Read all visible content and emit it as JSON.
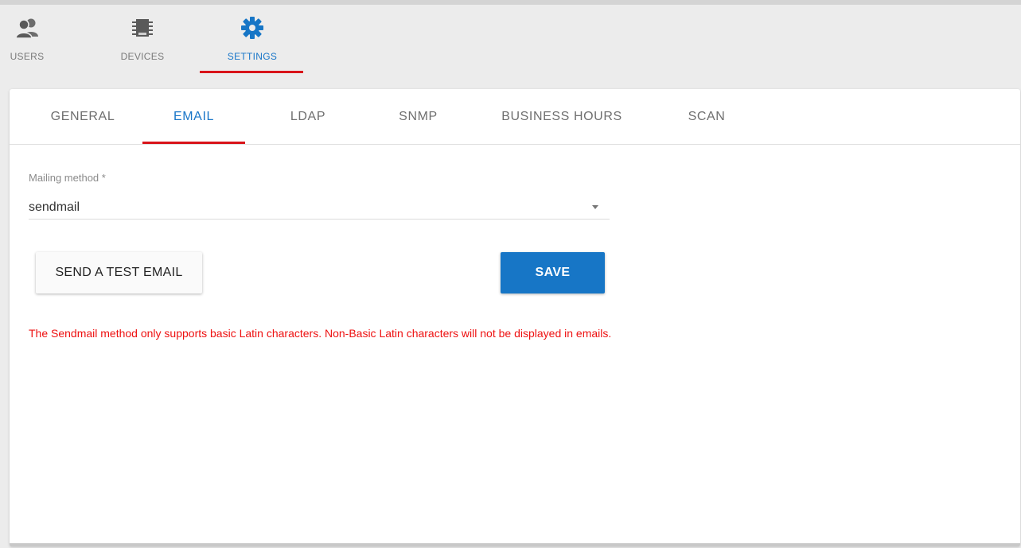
{
  "nav": {
    "items": [
      {
        "label": "USERS",
        "icon": "users-icon"
      },
      {
        "label": "DEVICES",
        "icon": "devices-icon"
      },
      {
        "label": "SETTINGS",
        "icon": "gear-icon"
      }
    ],
    "active": "SETTINGS"
  },
  "tabs": {
    "items": [
      "GENERAL",
      "EMAIL",
      "LDAP",
      "SNMP",
      "BUSINESS HOURS",
      "SCAN"
    ],
    "active": "EMAIL"
  },
  "form": {
    "mailing_method_label": "Mailing method *",
    "mailing_method_value": "sendmail",
    "test_button_label": "SEND A TEST EMAIL",
    "save_button_label": "SAVE",
    "warning": "The Sendmail method only supports basic Latin characters. Non-Basic Latin characters will not be displayed in emails."
  },
  "colors": {
    "accent_blue": "#1776c6",
    "active_underline": "#d8141a",
    "warning_red": "#ee1111"
  }
}
